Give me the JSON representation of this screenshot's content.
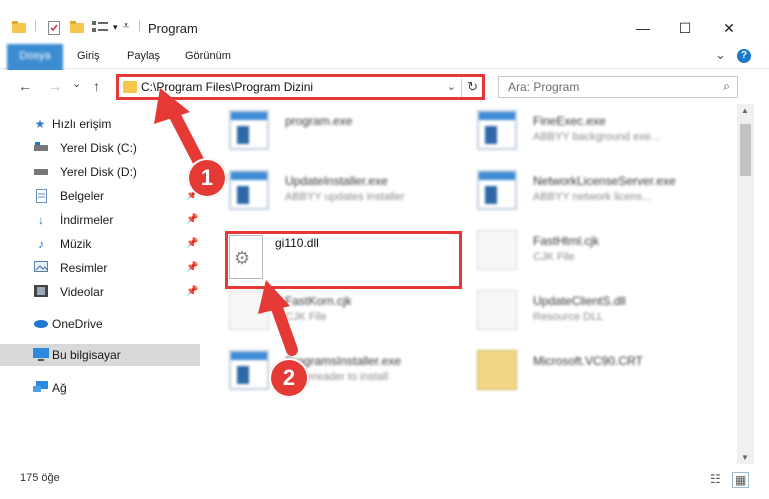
{
  "window": {
    "title": "Program",
    "minimize": "—",
    "maximize": "☐",
    "close": "✕"
  },
  "ribbon": {
    "tabs": [
      "Dosya",
      "Giriş",
      "Paylaş",
      "Görünüm"
    ],
    "expand": "⌄",
    "help": "?"
  },
  "nav": {
    "back": "←",
    "forward": "→",
    "recent": "⌄",
    "up": "↑",
    "address_path": "C:\\Program Files\\Program Dizini",
    "address_dropdown": "⌄",
    "refresh": "↻",
    "search_placeholder": "Ara: Program",
    "search_icon": "⌕"
  },
  "sidebar": {
    "items": [
      {
        "label": "Hızlı erişim",
        "icon": "star-icon"
      },
      {
        "label": "Yerel Disk (C:)",
        "icon": "drive-icon"
      },
      {
        "label": "Yerel Disk (D:)",
        "icon": "drive-icon"
      },
      {
        "label": "Belgeler",
        "icon": "document-icon"
      },
      {
        "label": "İndirmeler",
        "icon": "download-icon"
      },
      {
        "label": "Müzik",
        "icon": "music-icon"
      },
      {
        "label": "Resimler",
        "icon": "picture-icon"
      },
      {
        "label": "Videolar",
        "icon": "video-icon"
      },
      {
        "label": "OneDrive",
        "icon": "cloud-icon"
      },
      {
        "label": "Bu bilgisayar",
        "icon": "computer-icon"
      },
      {
        "label": "Ağ",
        "icon": "network-icon"
      }
    ]
  },
  "files": [
    {
      "name": "program.exe",
      "desc": ""
    },
    {
      "name": "FineExec.exe",
      "desc": "ABBYY background exe..."
    },
    {
      "name": "UpdateInstaller.exe",
      "desc": "ABBYY updates installer"
    },
    {
      "name": "NetworkLicenseServer.exe",
      "desc": "ABBYY network licens..."
    },
    {
      "name": "gi110.dll",
      "desc": ""
    },
    {
      "name": "FastHtml.cjk",
      "desc": "CJK File"
    },
    {
      "name": "FastKorn.cjk",
      "desc": "CJK File"
    },
    {
      "name": "UpdateClientS.dll",
      "desc": "Resource DLL"
    },
    {
      "name": "ProgramsInstaller.exe",
      "desc": "Y finereader to install"
    },
    {
      "name": "Microsoft.VC90.CRT",
      "desc": ""
    }
  ],
  "status": {
    "count": "175 öğe"
  },
  "annotations": {
    "step1": "1",
    "step2": "2"
  },
  "colors": {
    "accent": "#1979ca",
    "annotation_red": "#e53935"
  }
}
